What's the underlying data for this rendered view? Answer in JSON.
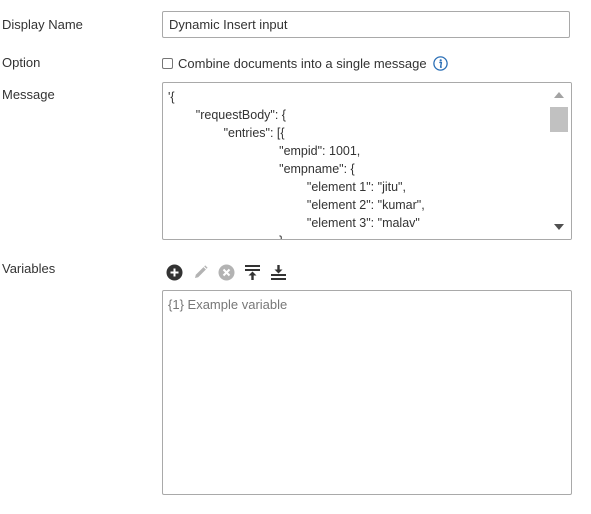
{
  "form": {
    "display_name": {
      "label": "Display Name",
      "value": "Dynamic Insert input"
    },
    "option": {
      "label": "Option",
      "checkbox_label": "Combine documents into a single message",
      "checked": false,
      "info_icon": "info-icon"
    },
    "message": {
      "label": "Message",
      "value": "'{\n        \"requestBody\": {\n                \"entries\": [{\n                                \"empid\": 1001,\n                                \"empname\": {\n                                        \"element 1\": \"jitu\",\n                                        \"element 2\": \"kumar\",\n                                        \"element 3\": \"malav\"\n                                }"
    },
    "variables": {
      "label": "Variables",
      "toolbar": [
        {
          "icon": "add-circle-icon",
          "enabled": true
        },
        {
          "icon": "pencil-edit-icon",
          "enabled": false
        },
        {
          "icon": "delete-x-circle-icon",
          "enabled": false
        },
        {
          "icon": "move-to-top-icon",
          "enabled": true
        },
        {
          "icon": "move-to-bottom-icon",
          "enabled": true
        }
      ],
      "items": [
        "{1} Example variable"
      ]
    }
  },
  "colors": {
    "border": "#a9a9a9",
    "text": "#333333",
    "placeholder_text": "#777777",
    "info_icon_blue": "#2b6fb6",
    "icon_dark": "#333333",
    "icon_disabled": "#b3b3b3"
  }
}
